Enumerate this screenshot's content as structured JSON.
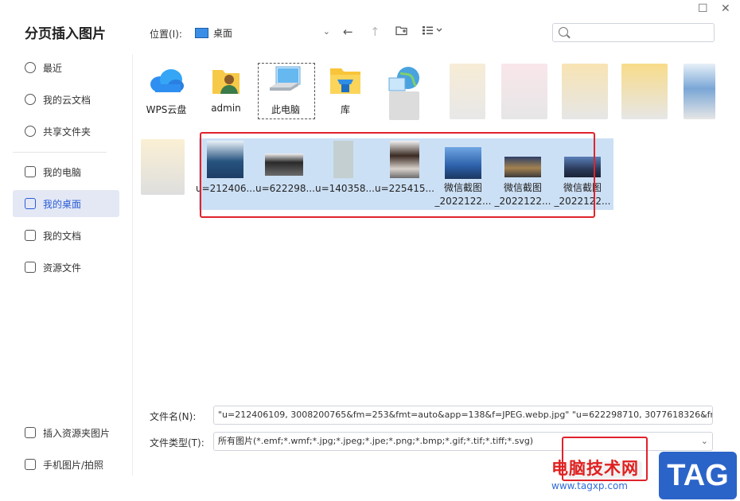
{
  "title": "分页插入图片",
  "sidebar": {
    "items": [
      {
        "label": "最近",
        "icon": "clock-icon"
      },
      {
        "label": "我的云文档",
        "icon": "cloud-icon"
      },
      {
        "label": "共享文件夹",
        "icon": "share-icon"
      },
      {
        "label": "我的电脑",
        "icon": "monitor-icon"
      },
      {
        "label": "我的桌面",
        "icon": "desktop-icon",
        "active": true
      },
      {
        "label": "我的文档",
        "icon": "folder-icon"
      },
      {
        "label": "资源文件",
        "icon": "folder-icon"
      }
    ],
    "bottom": [
      {
        "label": "插入资源夹图片",
        "icon": "folder-image-icon"
      },
      {
        "label": "手机图片/拍照",
        "icon": "phone-image-icon"
      }
    ]
  },
  "toolbar": {
    "location_label": "位置(I):",
    "location_value": "桌面"
  },
  "folders": [
    {
      "label": "WPS云盘",
      "icon": "wps-cloud-icon"
    },
    {
      "label": "admin",
      "icon": "user-folder-icon"
    },
    {
      "label": "此电脑",
      "icon": "computer-icon"
    },
    {
      "label": "库",
      "icon": "library-folder-icon"
    }
  ],
  "files": [
    {
      "name": "u=212406..."
    },
    {
      "name": "u=622298..."
    },
    {
      "name": "u=140358..."
    },
    {
      "name": "u=225415..."
    },
    {
      "name": "微信截图",
      "name2": "_2022122..."
    },
    {
      "name": "微信截图",
      "name2": "_2022122..."
    },
    {
      "name": "微信截图",
      "name2": "_2022122..."
    }
  ],
  "filename": {
    "label": "文件名(N):",
    "value": "\"u=212406109, 3008200765&fm=253&fmt=auto&app=138&f=JPEG.webp.jpg\" \"u=622298710, 3077618326&fm=253&fmt=a"
  },
  "filetype": {
    "label": "文件类型(T):",
    "value": "所有图片(*.emf;*.wmf;*.jpg;*.jpeg;*.jpe;*.png;*.bmp;*.gif;*.tif;*.tiff;*.svg)"
  },
  "watermark": {
    "text": "电脑技术网",
    "url": "www.tagxp.com",
    "tag": "TAG"
  }
}
